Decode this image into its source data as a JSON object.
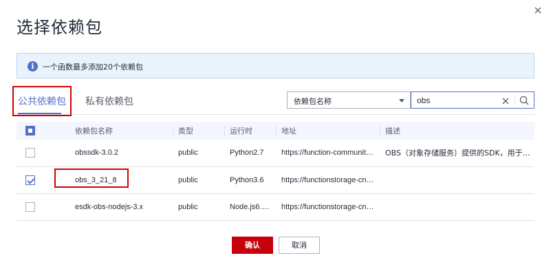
{
  "dialog": {
    "title": "选择依赖包",
    "close_icon": "close-icon"
  },
  "info": {
    "icon": "info-icon",
    "icon_glyph": "i",
    "text": "一个函数最多添加20个依赖包"
  },
  "tabs": [
    {
      "label": "公共依赖包",
      "active": true
    },
    {
      "label": "私有依赖包",
      "active": false
    }
  ],
  "filter": {
    "selected": "依赖包名称",
    "search_value": "obs"
  },
  "table": {
    "columns": [
      "依赖包名称",
      "类型",
      "运行时",
      "地址",
      "描述"
    ],
    "rows": [
      {
        "checked": false,
        "name": "obssdk-3.0.2",
        "type": "public",
        "runtime": "Python2.7",
        "address": "https://function-communit…",
        "description": "OBS（对象存储服务）提供的SDK，用于…"
      },
      {
        "checked": true,
        "name": "obs_3_21_8",
        "type": "public",
        "runtime": "Python3.6",
        "address": "https://functionstorage-cn…",
        "description": ""
      },
      {
        "checked": false,
        "name": "esdk-obs-nodejs-3.x",
        "type": "public",
        "runtime": "Node.js6.…",
        "address": "https://functionstorage-cn…",
        "description": ""
      }
    ]
  },
  "footer": {
    "confirm_label": "确认",
    "cancel_label": "取消"
  },
  "colors": {
    "accent": "#526ecc",
    "primary_button": "#c7000b",
    "highlight_box": "#d40000",
    "info_bg": "#eaf3fc"
  }
}
